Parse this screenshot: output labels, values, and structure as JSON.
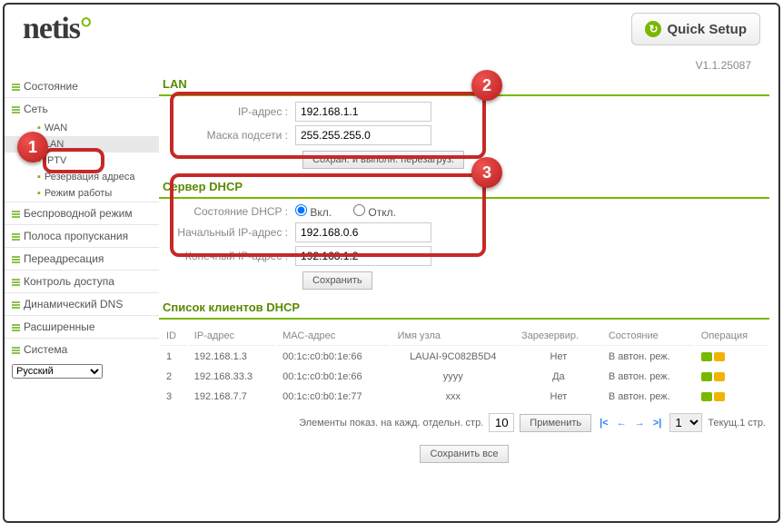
{
  "header": {
    "logo_text": "netis",
    "quick_setup": "Quick Setup",
    "version": "V1.1.25087"
  },
  "sidebar": {
    "status": "Состояние",
    "network": "Сеть",
    "wan": "WAN",
    "lan": "LAN",
    "iptv": "IPTV",
    "reservation": "Резервация адреса",
    "work_mode": "Режим работы",
    "wireless": "Беспроводной режим",
    "bandwidth": "Полоса пропускания",
    "forwarding": "Переадресация",
    "access": "Контроль доступа",
    "ddns": "Динамический DNS",
    "advanced": "Расширенные",
    "system": "Система",
    "language": "Русский"
  },
  "lan": {
    "title": "LAN",
    "ip_label": "IP-адрес :",
    "ip_value": "192.168.1.1",
    "mask_label": "Маска подсети :",
    "mask_value": "255.255.255.0",
    "save_reboot": "Сохран. и выполн. перезагруз."
  },
  "dhcp": {
    "title": "Сервер DHCP",
    "state_label": "Состояние DHCP :",
    "on": "Вкл.",
    "off": "Откл.",
    "start_label": "Начальный IP-адрес :",
    "start_value": "192.168.0.6",
    "end_label": "Конечный IP-адрес :",
    "end_value": "192.168.1.2",
    "save": "Сохранить"
  },
  "clients": {
    "title": "Список клиентов DHCP",
    "cols": {
      "id": "ID",
      "ip": "IP-адрес",
      "mac": "МАС-адрес",
      "host": "Имя узла",
      "reserved": "Зарезервир.",
      "state": "Состояние",
      "op": "Операция"
    },
    "rows": [
      {
        "id": "1",
        "ip": "192.168.1.3",
        "mac": "00:1c:c0:b0:1e:66",
        "host": "LAUAI-9C082B5D4",
        "reserved": "Нет",
        "state": "В автон. реж."
      },
      {
        "id": "2",
        "ip": "192.168.33.3",
        "mac": "00:1c:c0:b0:1e:66",
        "host": "уууу",
        "reserved": "Да",
        "state": "В автон. реж."
      },
      {
        "id": "3",
        "ip": "192.168.7.7",
        "mac": "00:1c:c0:b0:1e:77",
        "host": "ххх",
        "reserved": "Нет",
        "state": "В автон. реж."
      }
    ],
    "pager": {
      "items_label": "Элементы показ. на кажд. отдельн. стр.",
      "per_page": "10",
      "apply": "Применить",
      "page_value": "1",
      "current": "Текущ.1 стр."
    },
    "save_all": "Сохранить все"
  }
}
